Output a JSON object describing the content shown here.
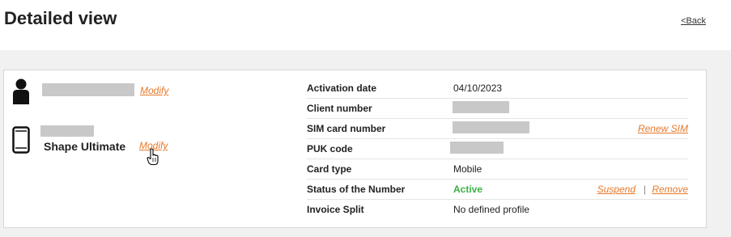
{
  "header": {
    "title": "Detailed view",
    "back_label": "<Back"
  },
  "left_panel": {
    "user": {
      "modify_label": "Modify"
    },
    "device": {
      "name": "Shape Ultimate",
      "modify_label": "Modify"
    }
  },
  "details": {
    "rows": [
      {
        "label": "Activation date",
        "value": "04/10/2023"
      },
      {
        "label": "Client number",
        "value": ""
      },
      {
        "label": "SIM card number",
        "value": "",
        "action": "Renew SIM"
      },
      {
        "label": "PUK code",
        "value": ""
      },
      {
        "label": "Card type",
        "value": "Mobile"
      },
      {
        "label": "Status of the Number",
        "value": "Active",
        "actions": [
          "Suspend",
          "Remove"
        ],
        "separator": "|"
      },
      {
        "label": "Invoice Split",
        "value": "No defined profile"
      }
    ]
  },
  "colors": {
    "link_orange": "#e8782a",
    "status_active_green": "#3cb043",
    "redaction_gray": "#c8c8c8"
  },
  "icons": [
    "user-icon",
    "smartphone-icon",
    "hand-pointer-cursor"
  ]
}
